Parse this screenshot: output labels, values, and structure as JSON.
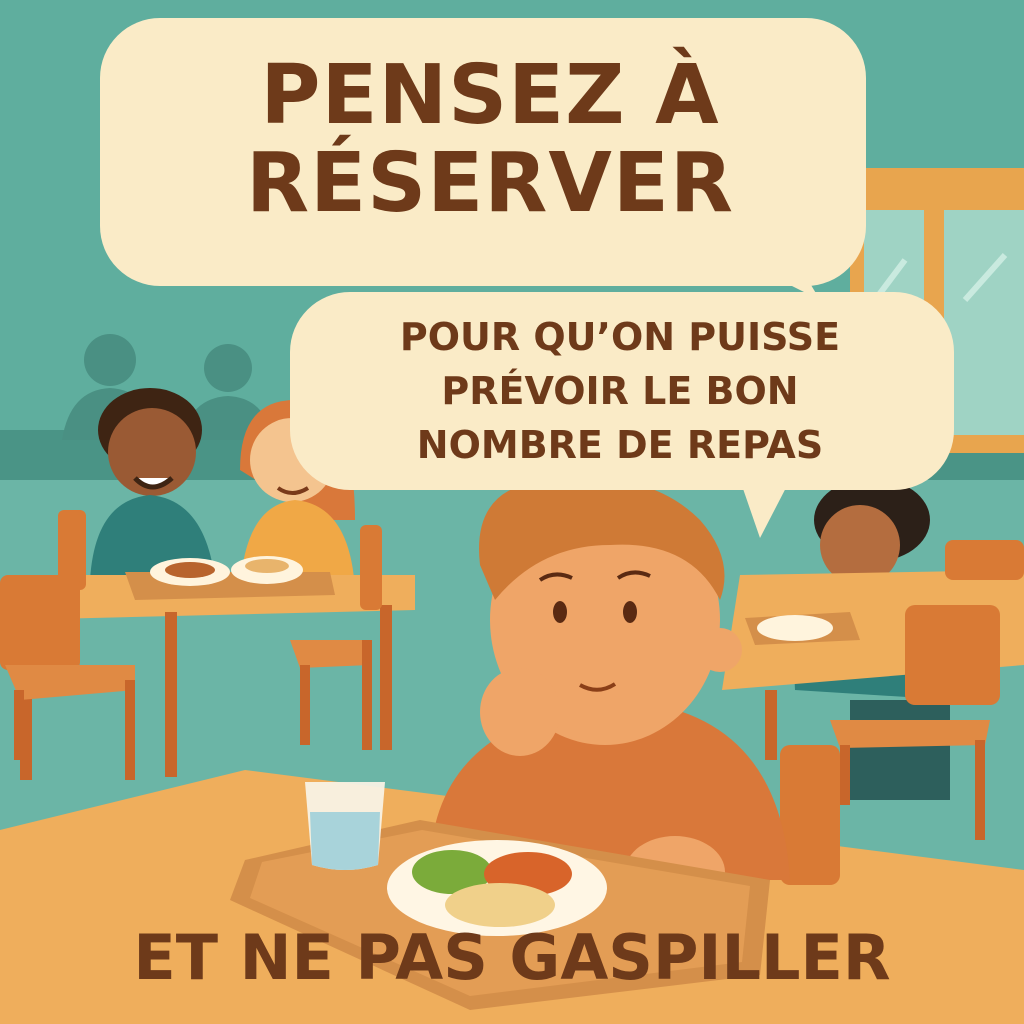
{
  "poster": {
    "title_line_1": "PENSEZ À",
    "title_line_2": "RÉSERVER",
    "subtitle_line_1": "POUR QU’ON PUISSE",
    "subtitle_line_2": "PRÉVOIR LE BON",
    "subtitle_line_3": "NOMBRE DE REPAS",
    "footer": "ET NE PAS GASPILLER"
  },
  "colors": {
    "wall": "#4f9e8f",
    "bubble": "#faebc7",
    "text": "#6e3a1a",
    "table": "#efae5c",
    "chair": "#d97a35"
  }
}
